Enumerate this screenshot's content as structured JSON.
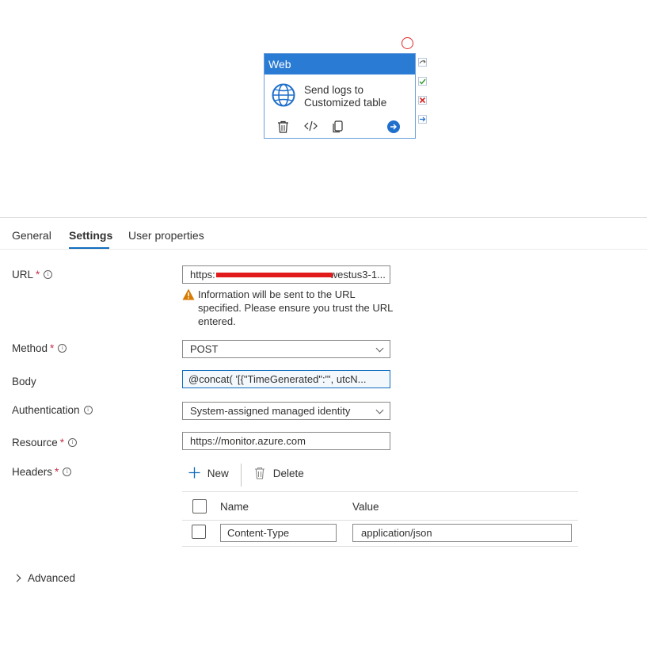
{
  "node": {
    "type_label": "Web",
    "name_line1": "Send logs to",
    "name_line2": "Customized table",
    "icons": [
      "globe-icon",
      "delete-icon",
      "code-icon",
      "copy-icon",
      "arrow-right-icon"
    ],
    "ports": [
      "skip-icon",
      "success-icon",
      "fail-icon",
      "completion-icon"
    ]
  },
  "tabs": [
    {
      "label": "General"
    },
    {
      "label": "Settings",
      "active": true
    },
    {
      "label": "User properties"
    }
  ],
  "form": {
    "url": {
      "label": "URL",
      "required": true,
      "value_prefix": "https:",
      "value_suffix": "westus3-1..."
    },
    "warning": "Information will be sent to the URL specified. Please ensure you trust the URL entered.",
    "method": {
      "label": "Method",
      "required": true,
      "value": "POST"
    },
    "body": {
      "label": "Body",
      "value": "@concat( '[{\"TimeGenerated\":\"', utcN..."
    },
    "authentication": {
      "label": "Authentication",
      "value": "System-assigned managed identity"
    },
    "resource": {
      "label": "Resource",
      "required": true,
      "value": "https://monitor.azure.com"
    },
    "headers": {
      "label": "Headers",
      "required": true,
      "new_label": "New",
      "delete_label": "Delete",
      "columns": {
        "name": "Name",
        "value": "Value"
      },
      "rows": [
        {
          "name": "Content-Type",
          "value": "application/json"
        }
      ]
    }
  },
  "advanced": {
    "label": "Advanced"
  },
  "colors": {
    "accent": "#0f6cbd",
    "node_header": "#2a7bd4",
    "required": "#c4314b",
    "warning": "#d87b00",
    "redaction": "#e11b1b"
  }
}
